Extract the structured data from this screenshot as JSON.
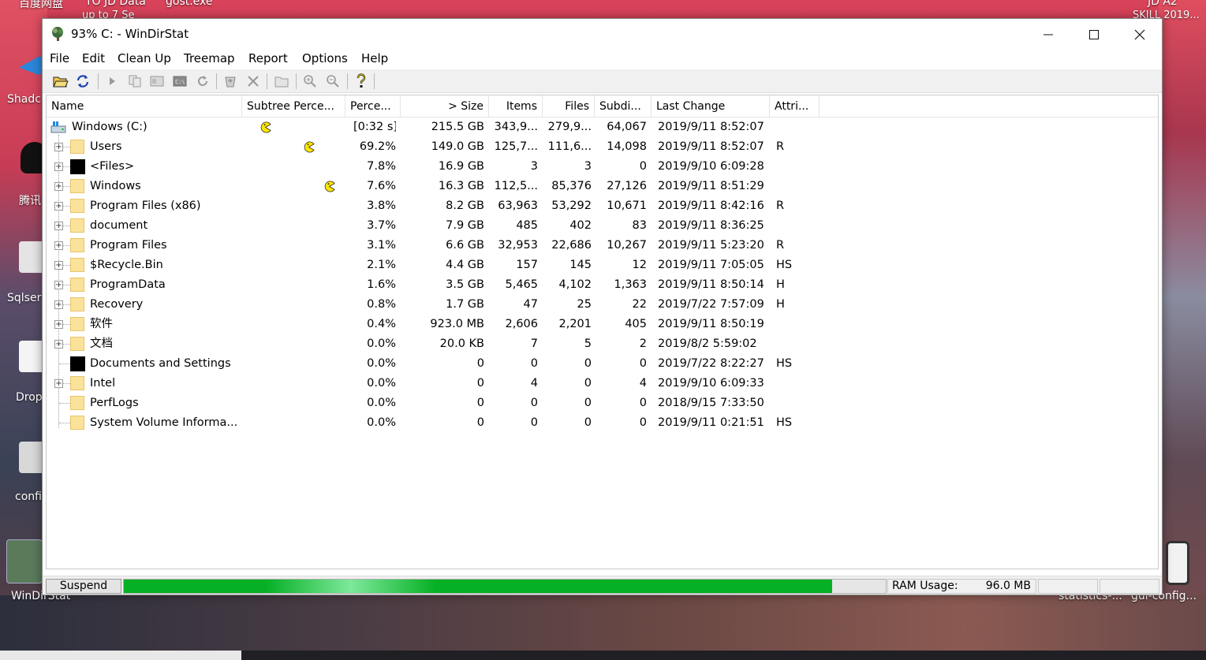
{
  "desktop": {
    "top_labels": [
      "百度网盘",
      "TO JD Data",
      "up to 7 Se",
      "gost.exe",
      "JD A2",
      "SKILL 2019..."
    ],
    "left_labels": [
      "Shadc",
      "腾讯",
      "Sqlser",
      "Drop",
      "confi",
      "WinDirStat"
    ],
    "right_labels": [
      "statistics-...",
      "gui-config..."
    ]
  },
  "window": {
    "title": "93% C: - WinDirStat",
    "controls": {
      "minimize": "—",
      "maximize": "☐",
      "close": "✕"
    }
  },
  "menu": [
    "File",
    "Edit",
    "Clean Up",
    "Treemap",
    "Report",
    "Options",
    "Help"
  ],
  "toolbar": {
    "icons": [
      "open-icon",
      "refresh-all-icon",
      "play-icon",
      "copy-path-icon",
      "explorer-icon",
      "command-prompt-icon",
      "refresh-selected-icon",
      "delete-recycle-icon",
      "delete-icon",
      "new-folder-icon",
      "zoom-in-icon",
      "zoom-out-icon",
      "help-icon"
    ]
  },
  "columns": [
    "Name",
    "Subtree Perce...",
    "Perce...",
    "> Size",
    "Items",
    "Files",
    "Subdi...",
    "Last Change",
    "Attri..."
  ],
  "root": {
    "name": "Windows (C:)",
    "percent": "[0:32 s]",
    "size": "215.5 GB",
    "items": "343,9...",
    "files": "279,9...",
    "subdirs": "64,067",
    "last_change": "2019/9/11  8:52:07",
    "attributes": ""
  },
  "rows": [
    {
      "name": "Users",
      "percent": "69.2%",
      "size": "149.0 GB",
      "items": "125,7...",
      "files": "111,6...",
      "subdirs": "14,098",
      "last_change": "2019/9/11  8:52:07",
      "attributes": "R"
    },
    {
      "name": "<Files>",
      "percent": "7.8%",
      "size": "16.9 GB",
      "items": "3",
      "files": "3",
      "subdirs": "0",
      "last_change": "2019/9/10  6:09:28",
      "attributes": ""
    },
    {
      "name": "Windows",
      "percent": "7.6%",
      "size": "16.3 GB",
      "items": "112,5...",
      "files": "85,376",
      "subdirs": "27,126",
      "last_change": "2019/9/11  8:51:29",
      "attributes": ""
    },
    {
      "name": "Program Files (x86)",
      "percent": "3.8%",
      "size": "8.2 GB",
      "items": "63,963",
      "files": "53,292",
      "subdirs": "10,671",
      "last_change": "2019/9/11  8:42:16",
      "attributes": "R"
    },
    {
      "name": "document",
      "percent": "3.7%",
      "size": "7.9 GB",
      "items": "485",
      "files": "402",
      "subdirs": "83",
      "last_change": "2019/9/11  8:36:25",
      "attributes": ""
    },
    {
      "name": "Program Files",
      "percent": "3.1%",
      "size": "6.6 GB",
      "items": "32,953",
      "files": "22,686",
      "subdirs": "10,267",
      "last_change": "2019/9/11  5:23:20",
      "attributes": "R"
    },
    {
      "name": "$Recycle.Bin",
      "percent": "2.1%",
      "size": "4.4 GB",
      "items": "157",
      "files": "145",
      "subdirs": "12",
      "last_change": "2019/9/11  7:05:05",
      "attributes": "HS"
    },
    {
      "name": "ProgramData",
      "percent": "1.6%",
      "size": "3.5 GB",
      "items": "5,465",
      "files": "4,102",
      "subdirs": "1,363",
      "last_change": "2019/9/11  8:50:14",
      "attributes": "H"
    },
    {
      "name": "Recovery",
      "percent": "0.8%",
      "size": "1.7 GB",
      "items": "47",
      "files": "25",
      "subdirs": "22",
      "last_change": "2019/7/22  7:57:09",
      "attributes": "H"
    },
    {
      "name": "软件",
      "percent": "0.4%",
      "size": "923.0 MB",
      "items": "2,606",
      "files": "2,201",
      "subdirs": "405",
      "last_change": "2019/9/11  8:50:19",
      "attributes": ""
    },
    {
      "name": "文档",
      "percent": "0.0%",
      "size": "20.0 KB",
      "items": "7",
      "files": "5",
      "subdirs": "2",
      "last_change": "2019/8/2  5:59:02",
      "attributes": ""
    },
    {
      "name": "Documents and Settings",
      "percent": "0.0%",
      "size": "0",
      "items": "0",
      "files": "0",
      "subdirs": "0",
      "last_change": "2019/7/22  8:22:27",
      "attributes": "HS"
    },
    {
      "name": "Intel",
      "percent": "0.0%",
      "size": "0",
      "items": "4",
      "files": "0",
      "subdirs": "4",
      "last_change": "2019/9/10  6:09:33",
      "attributes": ""
    },
    {
      "name": "PerfLogs",
      "percent": "0.0%",
      "size": "0",
      "items": "0",
      "files": "0",
      "subdirs": "0",
      "last_change": "2018/9/15  7:33:50",
      "attributes": ""
    },
    {
      "name": "System Volume Informa...",
      "percent": "0.0%",
      "size": "0",
      "items": "0",
      "files": "0",
      "subdirs": "0",
      "last_change": "2019/9/11  0:21:51",
      "attributes": "HS"
    }
  ],
  "status": {
    "suspend_label": "Suspend",
    "progress_fraction": 0.93,
    "ram_label": "RAM Usage:",
    "ram_value": "96.0 MB"
  },
  "colors": {
    "progress": "#06b025",
    "folder": "#fbe29a",
    "pacman": "#ffe600"
  }
}
